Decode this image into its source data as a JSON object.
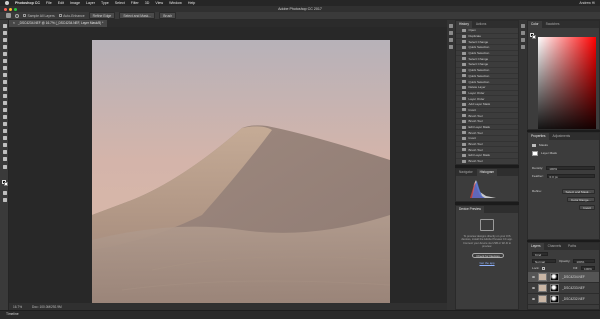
{
  "menubar": {
    "app_name": "Photoshop CC",
    "items": [
      "File",
      "Edit",
      "Image",
      "Layer",
      "Type",
      "Select",
      "Filter",
      "3D",
      "View",
      "Window",
      "Help"
    ],
    "status_right": "Andrew Hi"
  },
  "window": {
    "title": "Adobe Photoshop CC 2017"
  },
  "options_bar": {
    "checkbox_1": "Sample All Layers",
    "checkbox_2": "Auto-Enhance",
    "buttons": [
      "Refine Edge",
      "Select and Mask...",
      "Brush"
    ]
  },
  "document": {
    "tab_title": "_DSC4234.NEF @ 16.7% (_DSC4234.NEF, Layer Mask/8) *",
    "tab_close": "×"
  },
  "statusbar": {
    "zoom": "16.7%",
    "doc_info": "Doc: 100.0M/292.9M"
  },
  "timeline": {
    "label": "Timeline"
  },
  "history": {
    "tabs": [
      "History",
      "Actions"
    ],
    "items": [
      "Open",
      "Duplicate",
      "Select Change",
      "Quick Selection",
      "Quick Selection",
      "Select Change",
      "Select Change",
      "Quick Selection",
      "Quick Selection",
      "Quick Selection",
      "Delete Layer",
      "Layer Order",
      "Layer Order",
      "Add Layer Mask",
      "Invert",
      "Brush Tool",
      "Brush Tool",
      "Edit Layer Mask",
      "Brush Tool",
      "Invert",
      "Brush Tool",
      "Brush Tool",
      "Edit Layer Mask",
      "Brush Tool",
      "Invert",
      "Brush Tool"
    ],
    "selected_index": 25
  },
  "navigator": {
    "tabs": [
      "Navigator",
      "Histogram"
    ]
  },
  "device_preview": {
    "tabs": [
      "Device Preview"
    ],
    "message": "To preview designs directly on your iOS devices, install the Adobe Preview CC app. Connect your device via USB or Wi-Fi to preview.",
    "button": "Check for Devices",
    "link": "Get the app"
  },
  "color": {
    "tabs": [
      "Color",
      "Swatches"
    ]
  },
  "properties": {
    "tabs": [
      "Properties",
      "Adjustments"
    ],
    "section": "Masks",
    "layer_mask_label": "Layer Mask",
    "density_label": "Density:",
    "density_value": "100%",
    "feather_label": "Feather:",
    "feather_value": "0.0 px",
    "refine_label": "Refine:",
    "btn_select_mask": "Select and Mask...",
    "btn_color_range": "Color Range...",
    "btn_invert": "Invert"
  },
  "layers": {
    "tabs": [
      "Layers",
      "Channels",
      "Paths"
    ],
    "kind_label": "Kind",
    "blend_mode": "Normal",
    "opacity_label": "Opacity:",
    "opacity_value": "100%",
    "lock_label": "Lock:",
    "fill_label": "Fill:",
    "fill_value": "100%",
    "items": [
      "_DSC4234.NEF",
      "_DSC4233.NEF",
      "_DSC4232.NEF"
    ]
  }
}
